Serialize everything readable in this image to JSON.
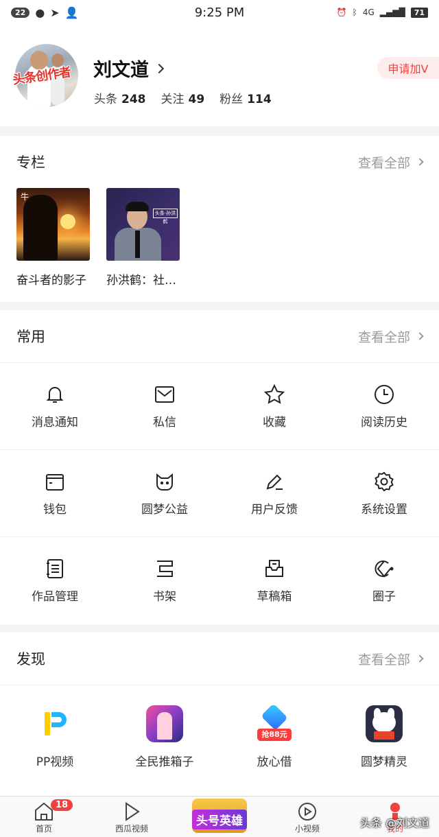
{
  "status_bar": {
    "notification_count": "22",
    "time": "9:25 PM",
    "network": "4G",
    "battery": "71"
  },
  "profile": {
    "avatar_caption": "头条创作者",
    "name": "刘文道",
    "stats": [
      {
        "label": "头条",
        "value": "248"
      },
      {
        "label": "关注",
        "value": "49"
      },
      {
        "label": "粉丝",
        "value": "114"
      }
    ],
    "apply_v_label": "申请加V"
  },
  "column_section": {
    "title": "专栏",
    "see_all": "查看全部",
    "items": [
      {
        "title": "奋斗者的影子",
        "thumb_text": "牛"
      },
      {
        "title": "孙洪鹤：社…",
        "thumb_text": "头条·孙洪鹤"
      }
    ]
  },
  "common_section": {
    "title": "常用",
    "see_all": "查看全部",
    "items": [
      {
        "label": "消息通知",
        "icon": "bell-icon"
      },
      {
        "label": "私信",
        "icon": "mail-icon"
      },
      {
        "label": "收藏",
        "icon": "star-icon"
      },
      {
        "label": "阅读历史",
        "icon": "clock-icon"
      },
      {
        "label": "钱包",
        "icon": "wallet-icon"
      },
      {
        "label": "圆梦公益",
        "icon": "cat-icon"
      },
      {
        "label": "用户反馈",
        "icon": "pen-icon"
      },
      {
        "label": "系统设置",
        "icon": "gear-icon"
      },
      {
        "label": "作品管理",
        "icon": "document-icon"
      },
      {
        "label": "书架",
        "icon": "bookshelf-icon"
      },
      {
        "label": "草稿箱",
        "icon": "draft-box-icon"
      },
      {
        "label": "圈子",
        "icon": "circle-group-icon"
      }
    ]
  },
  "discover_section": {
    "title": "发现",
    "see_all": "查看全部",
    "items": [
      {
        "label": "PP视频",
        "icon": "pp-video-app-icon"
      },
      {
        "label": "全民推箱子",
        "icon": "game-app-icon"
      },
      {
        "label": "放心借",
        "icon": "loan-app-icon",
        "badge": "抢88元"
      },
      {
        "label": "圆梦精灵",
        "icon": "dream-sprite-app-icon"
      }
    ]
  },
  "tab_bar": {
    "tabs": [
      {
        "label": "首页",
        "badge": "18"
      },
      {
        "label": "西瓜视频"
      },
      {
        "label": "头号英雄"
      },
      {
        "label": "小视频"
      },
      {
        "label": "我的"
      }
    ]
  },
  "watermark": "头条 @刘文道",
  "colors": {
    "accent": "#f04142",
    "muted": "#9a9a9a"
  }
}
